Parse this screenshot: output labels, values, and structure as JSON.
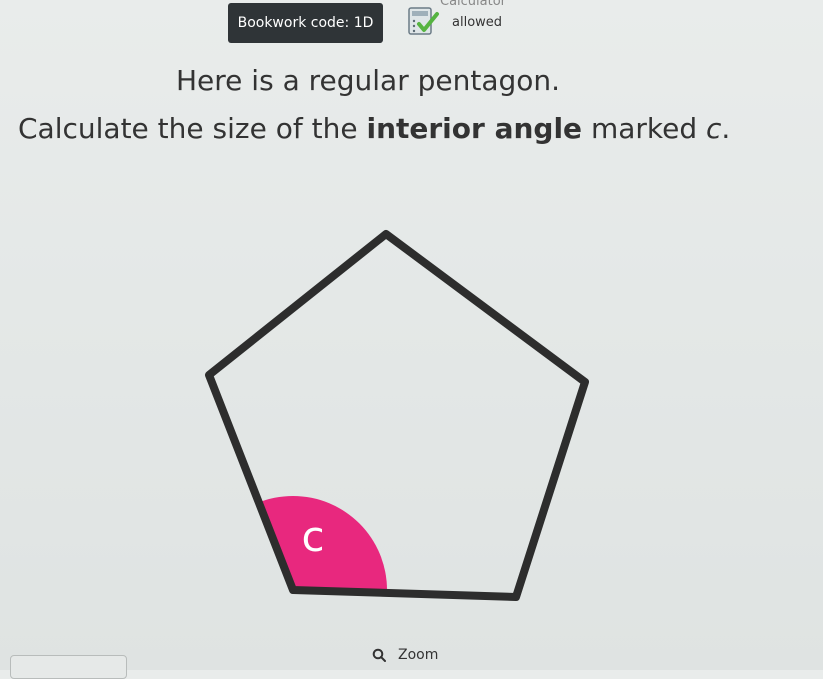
{
  "header": {
    "bookwork_code": "Bookwork code: 1D",
    "calculator_status_top": "Calculator",
    "calculator_status_bottom": "allowed",
    "calculator_icon": "calculator-check-icon"
  },
  "question": {
    "line1": "Here is a regular pentagon.",
    "line2_prefix": "Calculate the size of the ",
    "line2_bold": "interior angle",
    "line2_middle": " marked ",
    "line2_variable": "c",
    "line2_suffix": "."
  },
  "diagram": {
    "shape": "regular pentagon",
    "angle_label": "c",
    "angle_highlight_color": "#e8287e",
    "outline_color": "#2d2d2d"
  },
  "footer": {
    "zoom_label": "Zoom",
    "zoom_icon": "search-icon"
  }
}
